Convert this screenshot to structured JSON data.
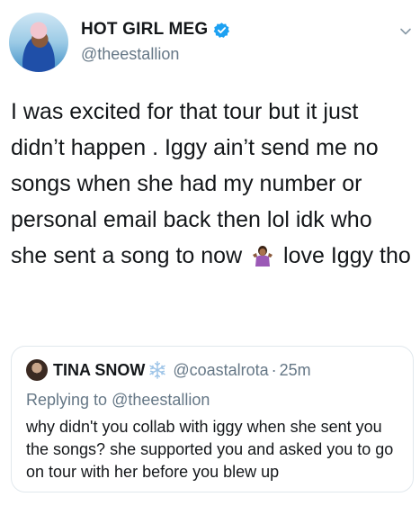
{
  "tweet": {
    "display_name": "HOT GIRL MEG",
    "handle": "@theestallion",
    "text_before_emoji": "I was excited for that tour but it just didn’t happen . Iggy ain’t send me no songs when she had my number or personal email back then lol idk who she sent a song to now",
    "emoji": "shrug-emoji",
    "text_after_emoji": "love Iggy tho",
    "verified_color": "#1da1f2",
    "icons": {
      "verified": "verified-badge-icon",
      "menu": "chevron-down-icon"
    }
  },
  "quote": {
    "display_name": "TINA SNOW",
    "name_emoji": "snowflake-icon",
    "handle": "@coastalrota",
    "separator": "·",
    "time": "25m",
    "replying_prefix": "Replying to",
    "replying_to": "@theestallion",
    "text": "why didn't you collab with iggy when she sent you the songs? she supported you and asked you to go on tour with her before you blew up"
  },
  "colors": {
    "text": "#14171a",
    "secondary": "#657786",
    "border": "#e1e8ed",
    "accent": "#1da1f2"
  }
}
